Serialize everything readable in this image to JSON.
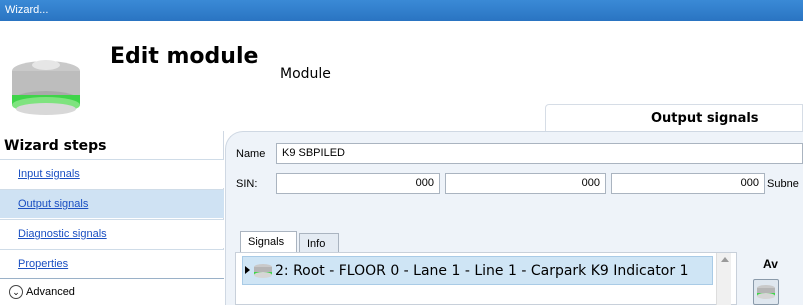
{
  "window": {
    "title": "Wizard..."
  },
  "header": {
    "title": "Edit module",
    "subtitle": "Module",
    "logo_icon": "sensor-module-icon",
    "output_tab_label": "Output signals"
  },
  "sidebar": {
    "title": "Wizard steps",
    "items": [
      {
        "label": "Input signals",
        "active": false
      },
      {
        "label": "Output signals",
        "active": true
      },
      {
        "label": "Diagnostic signals",
        "active": false
      },
      {
        "label": "Properties",
        "active": false
      }
    ],
    "advanced": {
      "label": "Advanced",
      "icon": "chevron-down-circle-icon"
    }
  },
  "form": {
    "name_label": "Name",
    "name_value": "K9 SBPILED",
    "sin_label": "SIN:",
    "sin_values": [
      "000",
      "000",
      "000"
    ],
    "subnet_label": "Subne"
  },
  "tabs": [
    {
      "label": "Signals",
      "active": true
    },
    {
      "label": "Info",
      "active": false
    }
  ],
  "signals": [
    {
      "text": "2: Root - FLOOR 0 - Lane 1 - Line 1 - Carpark K9 Indicator 1",
      "icon": "indicator-light-icon"
    }
  ],
  "right_panel": {
    "label": "Av",
    "icon": "indicator-light-icon"
  },
  "colors": {
    "titlebar": "#2f7ecb",
    "selection": "#cfe5f5",
    "accent_green": "#3fd44a",
    "link": "#1a4fc2"
  }
}
